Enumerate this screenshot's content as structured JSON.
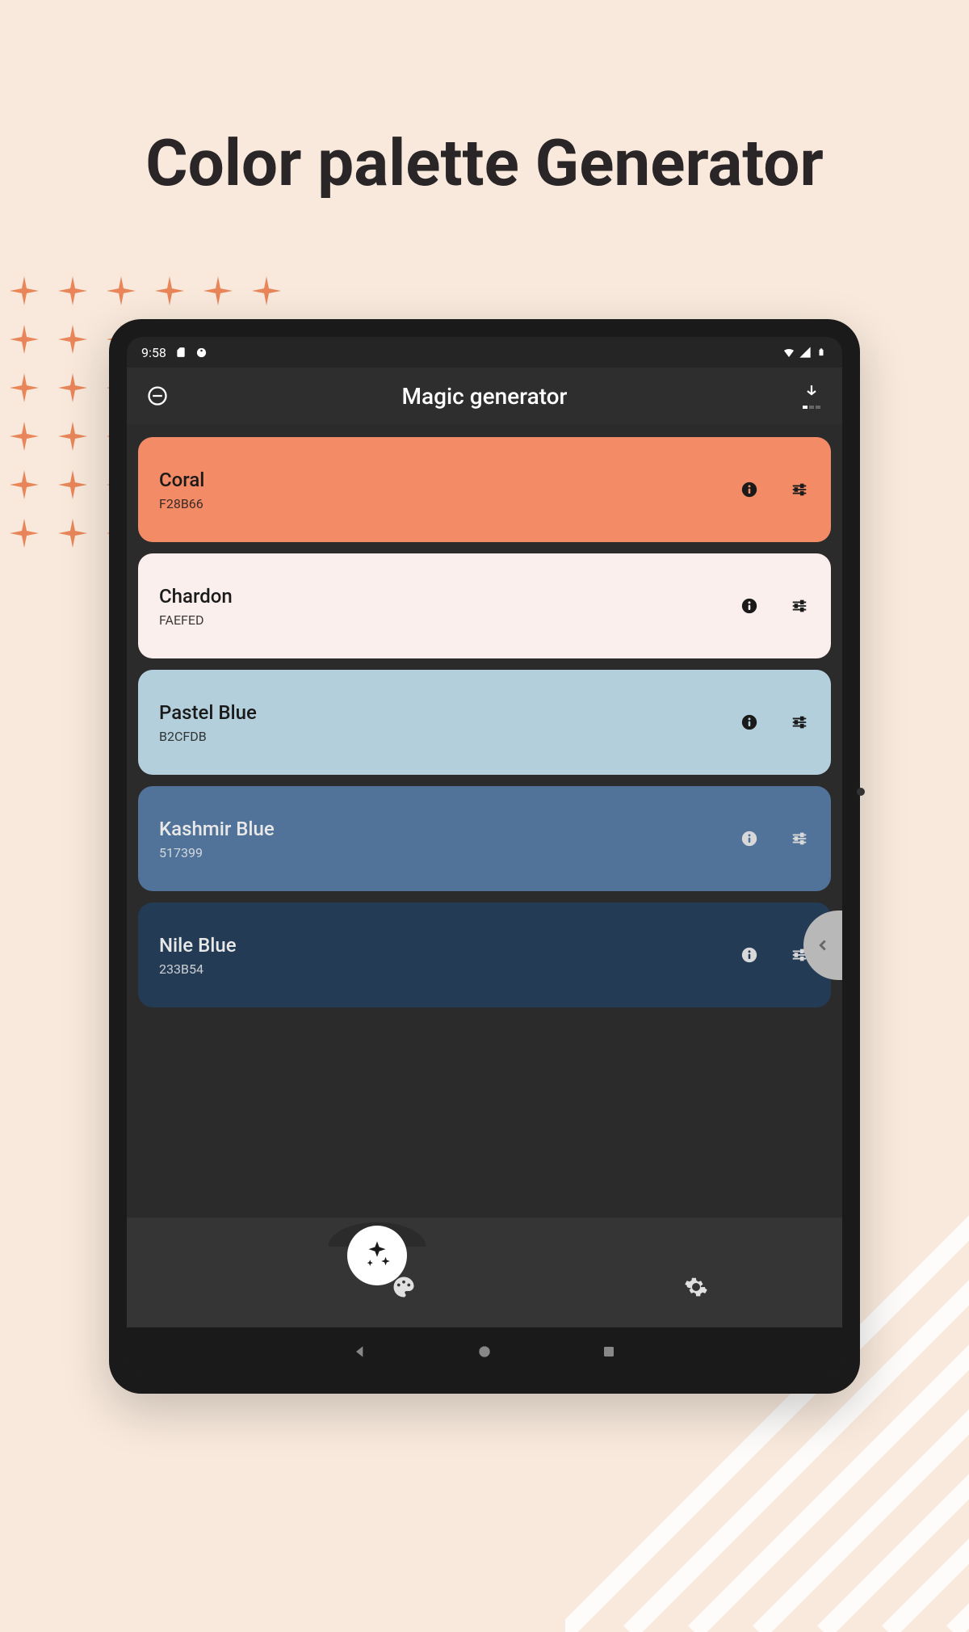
{
  "page": {
    "title": "Color palette Generator"
  },
  "status_bar": {
    "time": "9:58"
  },
  "header": {
    "title": "Magic generator"
  },
  "colors": [
    {
      "name": "Coral",
      "hex": "F28B66",
      "bg": "#F28B66",
      "text": "dark",
      "info_bg": "#1a1a1a",
      "info_fg": "#F28B66",
      "tune_color": "#1a1a1a"
    },
    {
      "name": "Chardon",
      "hex": "FAEFED",
      "bg": "#FAEFED",
      "text": "dark",
      "info_bg": "#1a1a1a",
      "info_fg": "#FAEFED",
      "tune_color": "#1a1a1a"
    },
    {
      "name": "Pastel Blue",
      "hex": "B2CFDB",
      "bg": "#B2CFDB",
      "text": "dark",
      "info_bg": "#1a1a1a",
      "info_fg": "#B2CFDB",
      "tune_color": "#1a1a1a"
    },
    {
      "name": "Kashmir Blue",
      "hex": "517399",
      "bg": "#517399",
      "text": "light",
      "info_bg": "#d8d8d8",
      "info_fg": "#517399",
      "tune_color": "#d8d8d8"
    },
    {
      "name": "Nile Blue",
      "hex": "233B54",
      "bg": "#233B54",
      "text": "light",
      "info_bg": "#d8d8d8",
      "info_fg": "#233B54",
      "tune_color": "#d8d8d8"
    }
  ],
  "accent_color": "#E8865A"
}
